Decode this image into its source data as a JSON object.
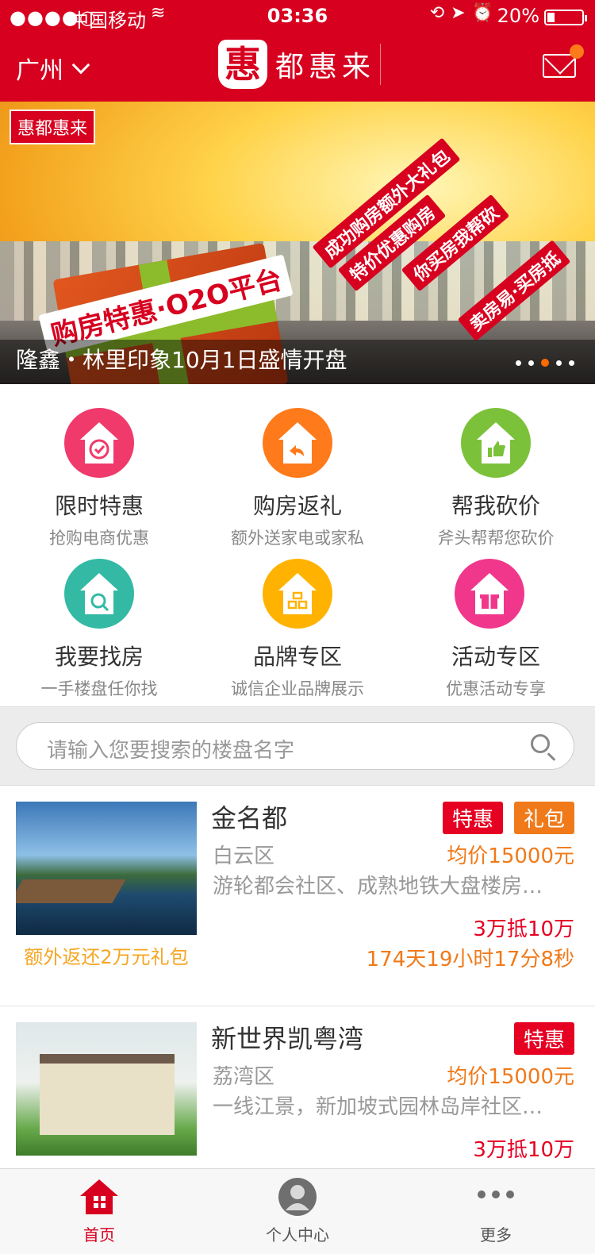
{
  "status_bar": {
    "signal": "●●●●○",
    "carrier": "中国移动",
    "time": "03:36",
    "battery": "20%"
  },
  "header": {
    "city": "广州",
    "logo_mark": "惠",
    "logo_text": "都惠来",
    "has_unread_mail": true
  },
  "banner": {
    "brand": "惠都惠来",
    "slogan": "购房特惠·O2O平台",
    "side_texts": [
      "成功购房额外大礼包",
      "特价优惠购房",
      "你买房我帮砍",
      "卖房易·买房抵"
    ],
    "caption": "隆鑫・林里印象10月1日盛情开盘",
    "slides": 5,
    "active_slide": 3
  },
  "features": [
    {
      "title": "限时特惠",
      "subtitle": "抢购电商优惠",
      "icon": "timer-house-icon",
      "color": "#f03a6b"
    },
    {
      "title": "购房返礼",
      "subtitle": "额外送家电或家私",
      "icon": "return-house-icon",
      "color": "#ff7a1a"
    },
    {
      "title": "帮我砍价",
      "subtitle": "斧头帮帮您砍价",
      "icon": "thumbs-house-icon",
      "color": "#7cc13a"
    },
    {
      "title": "我要找房",
      "subtitle": "一手楼盘任你找",
      "icon": "search-house-icon",
      "color": "#33b9a4"
    },
    {
      "title": "品牌专区",
      "subtitle": "诚信企业品牌展示",
      "icon": "brand-house-icon",
      "color": "#ffb300"
    },
    {
      "title": "活动专区",
      "subtitle": "优惠活动专享",
      "icon": "gift-house-icon",
      "color": "#f0378c"
    }
  ],
  "search": {
    "placeholder": "请输入您要搜索的楼盘名字"
  },
  "listings": [
    {
      "name": "金名都",
      "tags": [
        "特惠",
        "礼包"
      ],
      "district": "白云区",
      "price": "均价15000元",
      "desc": "游轮都会社区、成熟地铁大盘楼房…",
      "deal": "3万抵10万",
      "countdown": "174天19小时17分8秒",
      "gift_note": "额外返还2万元礼包"
    },
    {
      "name": "新世界凯粤湾",
      "tags": [
        "特惠"
      ],
      "district": "荔湾区",
      "price": "均价15000元",
      "desc": "一线江景，新加坡式园林岛岸社区…",
      "deal": "3万抵10万"
    }
  ],
  "tabbar": [
    {
      "label": "首页",
      "icon": "home-icon",
      "active": true
    },
    {
      "label": "个人中心",
      "icon": "user-icon",
      "active": false
    },
    {
      "label": "更多",
      "icon": "more-icon",
      "active": false
    }
  ]
}
